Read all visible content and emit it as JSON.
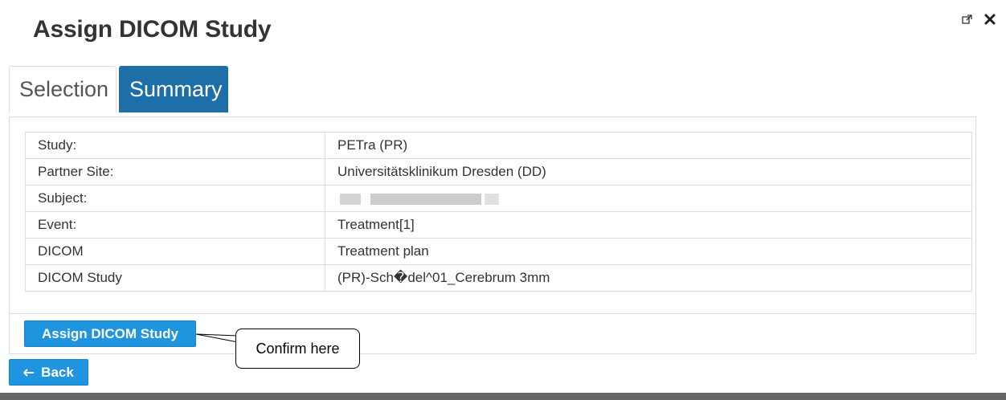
{
  "window": {
    "title": "Assign DICOM Study"
  },
  "icons": {
    "external": "external-link-icon",
    "close": "close-icon"
  },
  "tabs": [
    {
      "label": "Selection",
      "active": false
    },
    {
      "label": "Summary",
      "active": true
    }
  ],
  "summary": {
    "rows": [
      {
        "label": "Study:",
        "value": "PETra (PR)"
      },
      {
        "label": "Partner Site:",
        "value": "Universitätsklinikum Dresden (DD)"
      },
      {
        "label": "Subject:",
        "value": ""
      },
      {
        "label": "Event:",
        "value": "Treatment[1]"
      },
      {
        "label": "DICOM",
        "value": "Treatment plan"
      },
      {
        "label": "DICOM Study",
        "value": "(PR)-Sch�del^01_Cerebrum 3mm"
      }
    ]
  },
  "actions": {
    "assign_label": "Assign DICOM Study",
    "back_label": "Back"
  },
  "annotation": {
    "text": "Confirm here"
  },
  "colors": {
    "primary": "#1f95e0",
    "active_tab": "#1e6fa8",
    "border": "#dddddd"
  }
}
